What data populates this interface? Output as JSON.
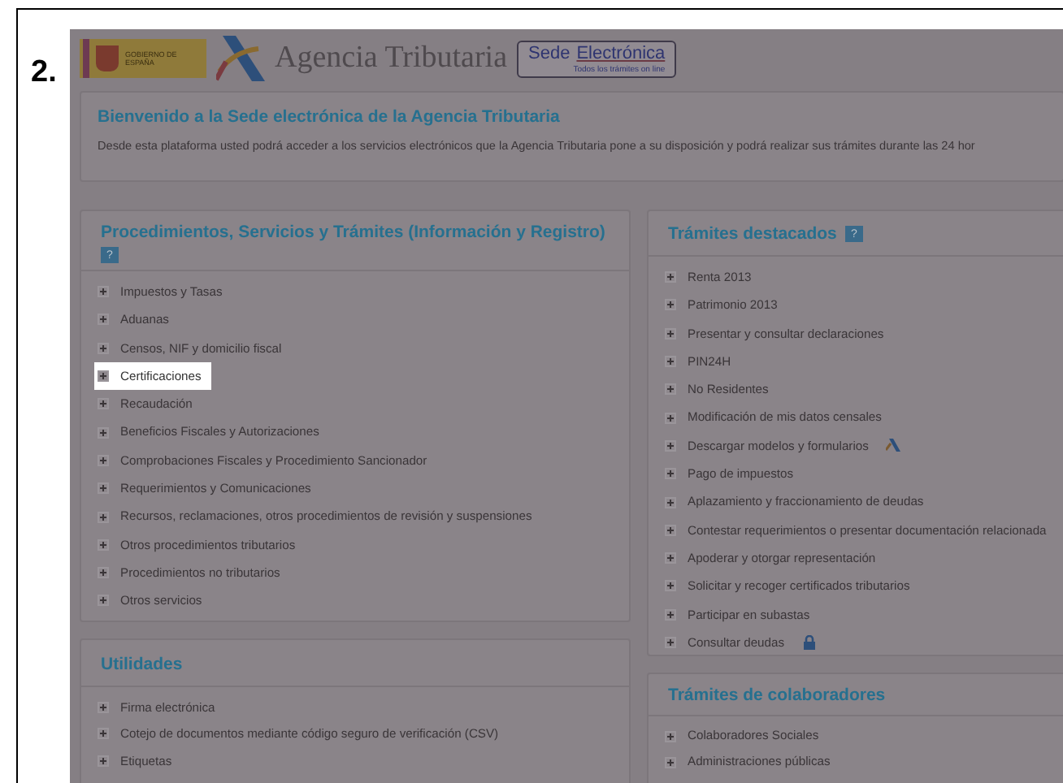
{
  "figure_label": "2.",
  "header": {
    "gov_logo_text": "GOBIERNO DE ESPAÑA",
    "agency_name": "Agencia Tributaria",
    "sede_badge": {
      "title_plain": "Sede",
      "title_link": "Electrónica",
      "subtitle": "Todos los trámites on line"
    }
  },
  "welcome": {
    "title": "Bienvenido a la Sede electrónica de la Agencia Tributaria",
    "text": "Desde esta plataforma usted podrá acceder a los servicios electrónicos que la Agencia Tributaria pone a su disposición y podrá realizar sus trámites durante las 24 hor"
  },
  "procedures": {
    "title": "Procedimientos, Servicios y Trámites (Información y Registro)",
    "help": "?",
    "items": [
      {
        "label": "Impuestos y Tasas",
        "selected": false
      },
      {
        "label": "Aduanas",
        "selected": false
      },
      {
        "label": "Censos, NIF y domicilio fiscal",
        "selected": false
      },
      {
        "label": "Certificaciones",
        "selected": true
      },
      {
        "label": "Recaudación",
        "selected": false
      },
      {
        "label": "Beneficios Fiscales y Autorizaciones",
        "selected": false
      },
      {
        "label": "Comprobaciones Fiscales y Procedimiento Sancionador",
        "selected": false
      },
      {
        "label": "Requerimientos y Comunicaciones",
        "selected": false
      },
      {
        "label": "Recursos, reclamaciones, otros procedimientos de revisión y suspensiones",
        "selected": false
      },
      {
        "label": "Otros procedimientos tributarios",
        "selected": false
      },
      {
        "label": "Procedimientos no tributarios",
        "selected": false
      },
      {
        "label": "Otros servicios",
        "selected": false
      }
    ]
  },
  "featured": {
    "title": "Trámites destacados",
    "help": "?",
    "items": [
      {
        "label": "Renta 2013",
        "kind": "plain"
      },
      {
        "label": "Patrimonio 2013",
        "kind": "plain"
      },
      {
        "label": "Presentar y consultar declaraciones",
        "kind": "plain"
      },
      {
        "label": "PIN24H",
        "kind": "plain"
      },
      {
        "label": "No Residentes",
        "kind": "plain"
      },
      {
        "label": "Modificación de mis datos censales",
        "kind": "plain"
      },
      {
        "label": "Descargar modelos y formularios",
        "kind": "logo"
      },
      {
        "label": "Pago de impuestos",
        "kind": "plain"
      },
      {
        "label": "Aplazamiento y fraccionamiento de deudas",
        "kind": "plain"
      },
      {
        "label": "Contestar requerimientos o presentar documentación relacionada",
        "kind": "plain"
      },
      {
        "label": "Apoderar y otorgar representación",
        "kind": "plain"
      },
      {
        "label": "Solicitar y recoger certificados tributarios",
        "kind": "plain"
      },
      {
        "label": "Participar en subastas",
        "kind": "plain"
      },
      {
        "label": "Consultar deudas",
        "kind": "lock"
      }
    ]
  },
  "utilities": {
    "title": "Utilidades",
    "items": [
      {
        "label": "Firma electrónica"
      },
      {
        "label": "Cotejo de documentos mediante código seguro de verificación (CSV)"
      },
      {
        "label": "Etiquetas"
      }
    ]
  },
  "collaborators": {
    "title": "Trámites de colaboradores",
    "items": [
      {
        "label": "Colaboradores Sociales"
      },
      {
        "label": "Administraciones públicas"
      }
    ]
  }
}
